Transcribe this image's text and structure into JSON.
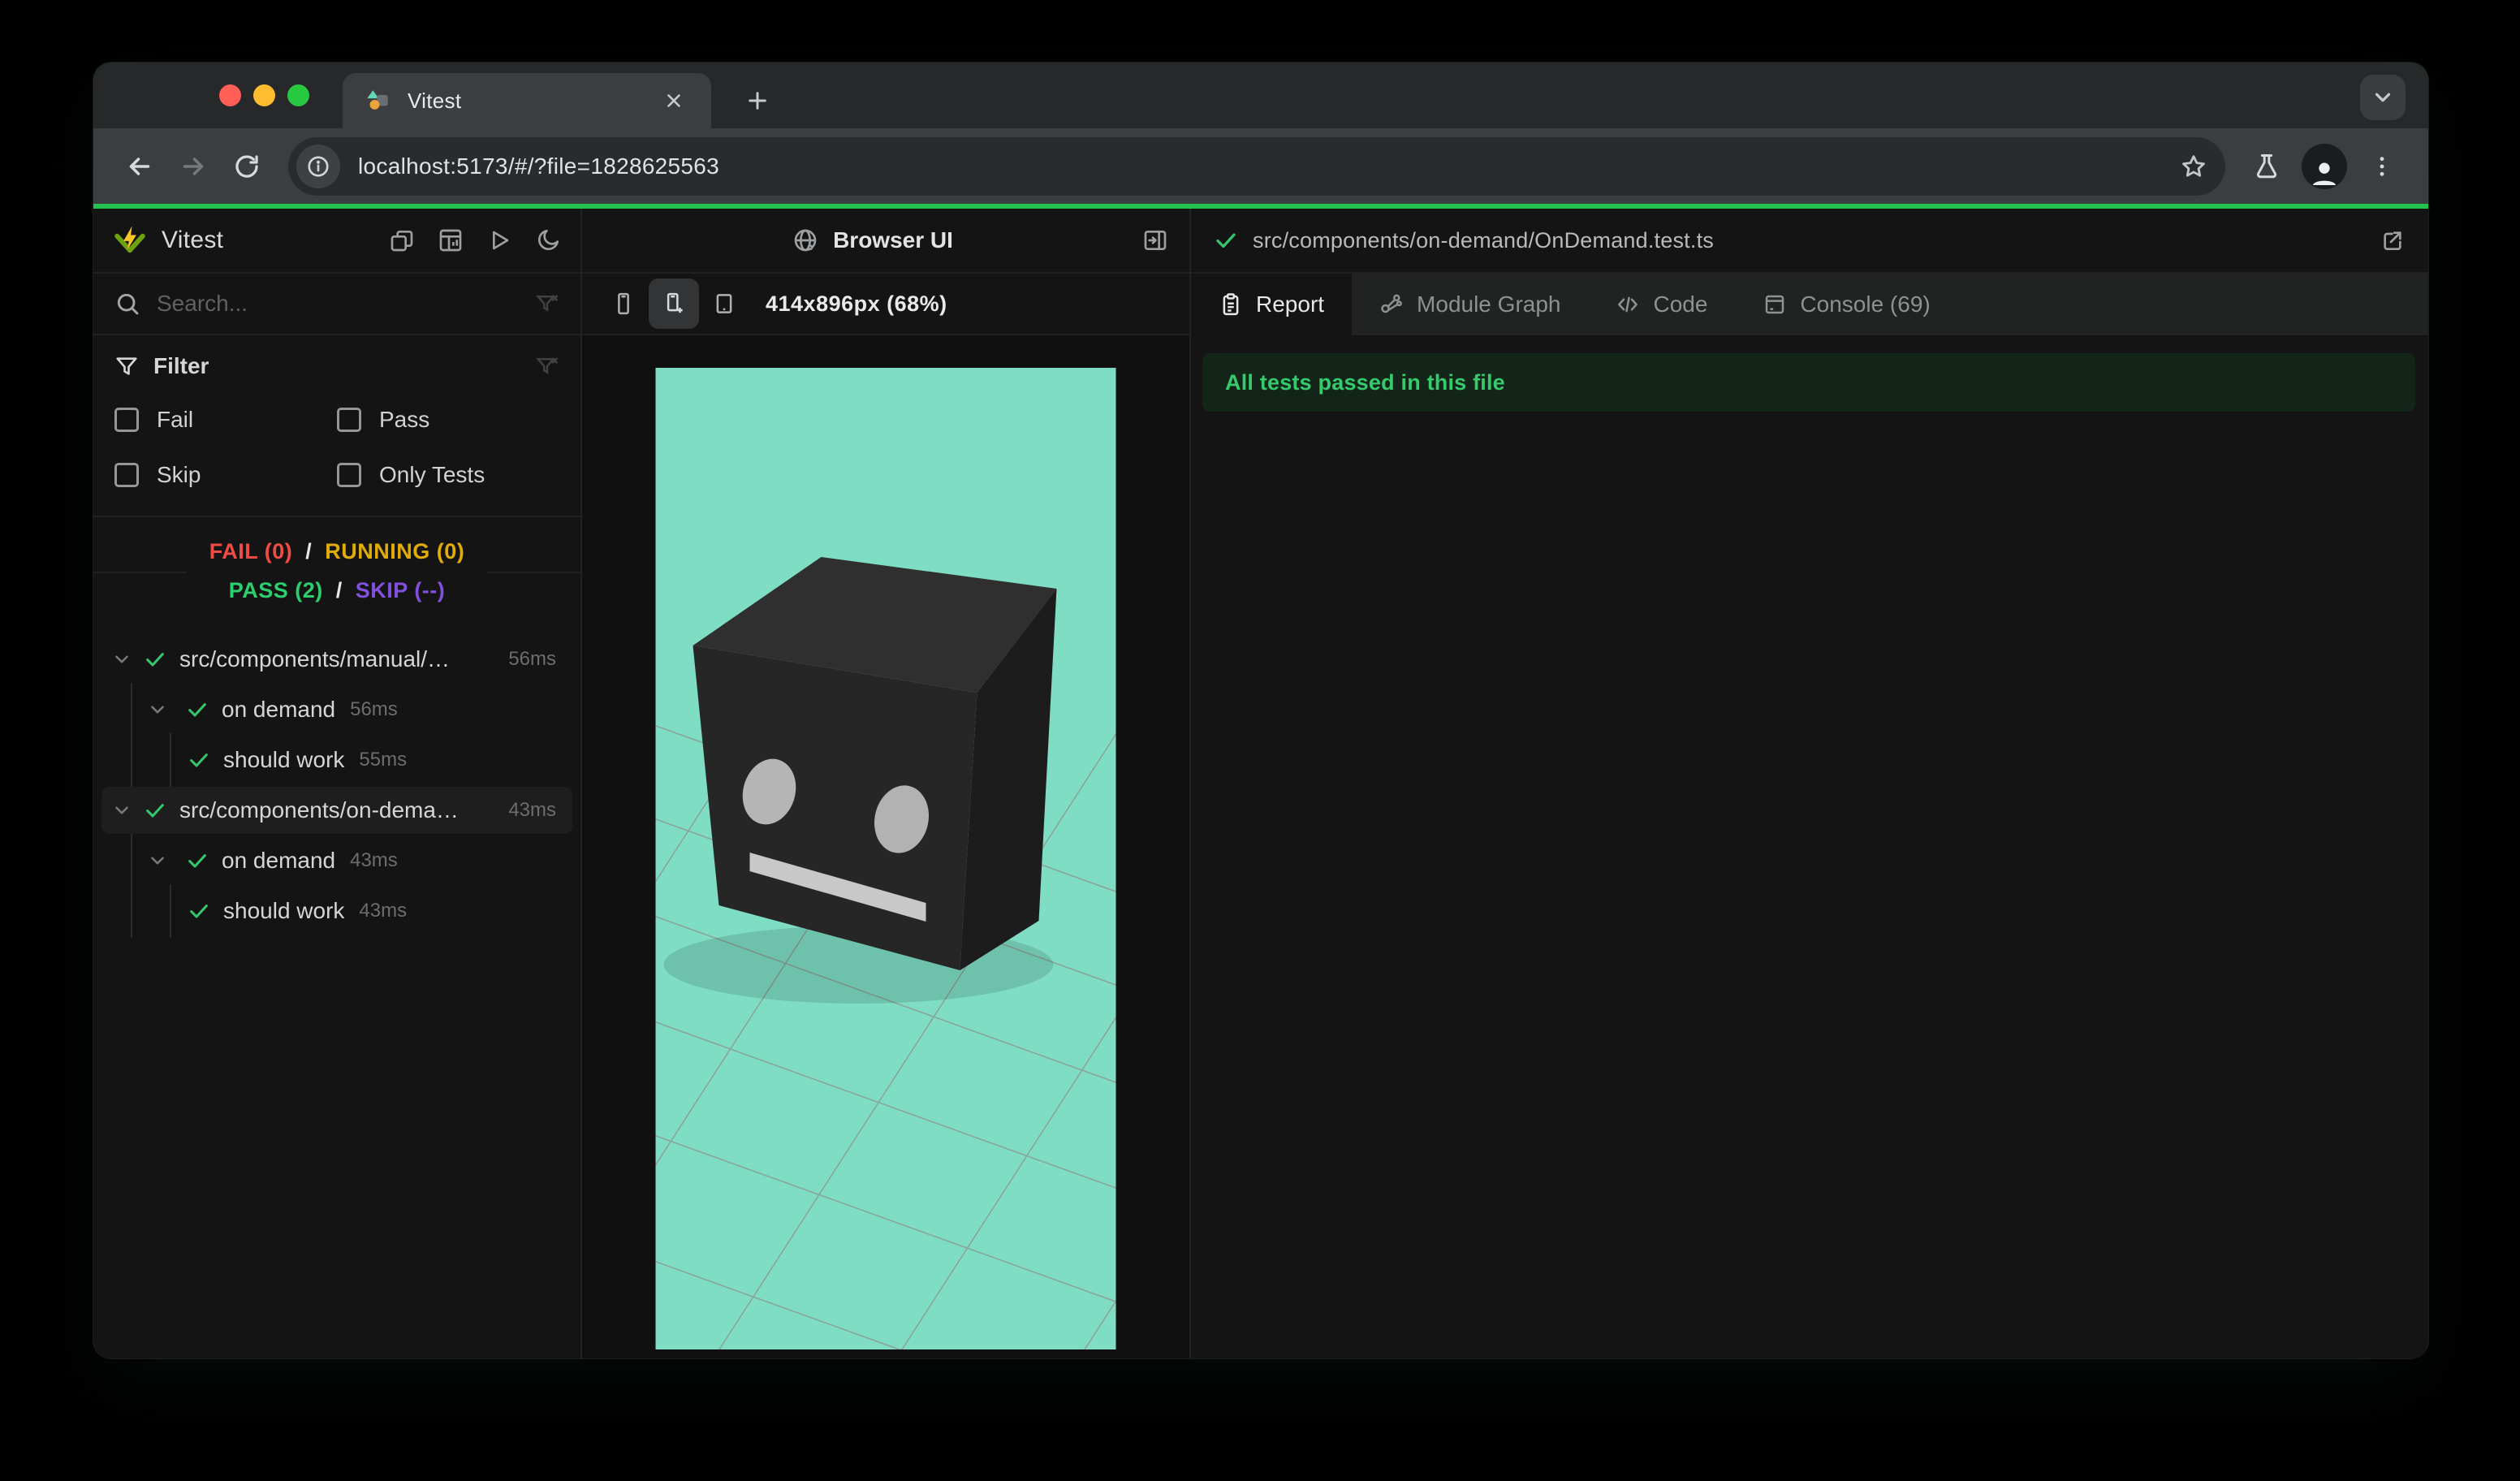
{
  "colors": {
    "accent_green": "#24c351",
    "pass_green": "#2bcf6e",
    "fail_red": "#f24a45",
    "running_yellow": "#e2ac06",
    "skip_purple": "#8250dd",
    "viewport_background": "#7eddc3",
    "cube_top": "#2f2f2f",
    "cube_front": "#262626",
    "cube_side": "#1c1c1c",
    "cube_eye": "#b5b5b5",
    "banner_background": "#132419"
  },
  "browser_chrome": {
    "tab_title": "Vitest",
    "url": "localhost:5173/#/?file=1828625563"
  },
  "sidebar": {
    "title": "Vitest",
    "search_placeholder": "Search...",
    "filter": {
      "heading": "Filter",
      "options": [
        "Fail",
        "Pass",
        "Skip",
        "Only Tests"
      ]
    },
    "summary": {
      "line1": [
        {
          "text": "FAIL (0)",
          "class": "c-fail"
        },
        {
          "text": "/",
          "class": "c-sep"
        },
        {
          "text": "RUNNING (0)",
          "class": "c-run"
        }
      ],
      "line2": [
        {
          "text": "PASS (2)",
          "class": "c-pass"
        },
        {
          "text": "/",
          "class": "c-sep"
        },
        {
          "text": "SKIP (--)",
          "class": "c-skip"
        }
      ]
    },
    "tree": [
      {
        "level": 1,
        "chevron": true,
        "label": "src/components/manual/…",
        "time": "56ms",
        "time_right": true,
        "highlighted": false
      },
      {
        "level": 2,
        "chevron": true,
        "label": "on demand",
        "time": "56ms",
        "time_right": false,
        "highlighted": false
      },
      {
        "level": 3,
        "chevron": false,
        "label": "should work",
        "time": "55ms",
        "time_right": false,
        "highlighted": false
      },
      {
        "level": 1,
        "chevron": true,
        "label": "src/components/on-dema…",
        "time": "43ms",
        "time_right": true,
        "highlighted": true
      },
      {
        "level": 2,
        "chevron": true,
        "label": "on demand",
        "time": "43ms",
        "time_right": false,
        "highlighted": false
      },
      {
        "level": 3,
        "chevron": false,
        "label": "should work",
        "time": "43ms",
        "time_right": false,
        "highlighted": false
      }
    ]
  },
  "browser_panel": {
    "title": "Browser UI",
    "viewport_label": "414x896px (68%)"
  },
  "report_panel": {
    "file_path": "src/components/on-demand/OnDemand.test.ts",
    "tabs": [
      {
        "label": "Report",
        "active": true
      },
      {
        "label": "Module Graph",
        "active": false
      },
      {
        "label": "Code",
        "active": false
      },
      {
        "label": "Console (69)",
        "active": false
      }
    ],
    "banner": "All tests passed in this file"
  }
}
